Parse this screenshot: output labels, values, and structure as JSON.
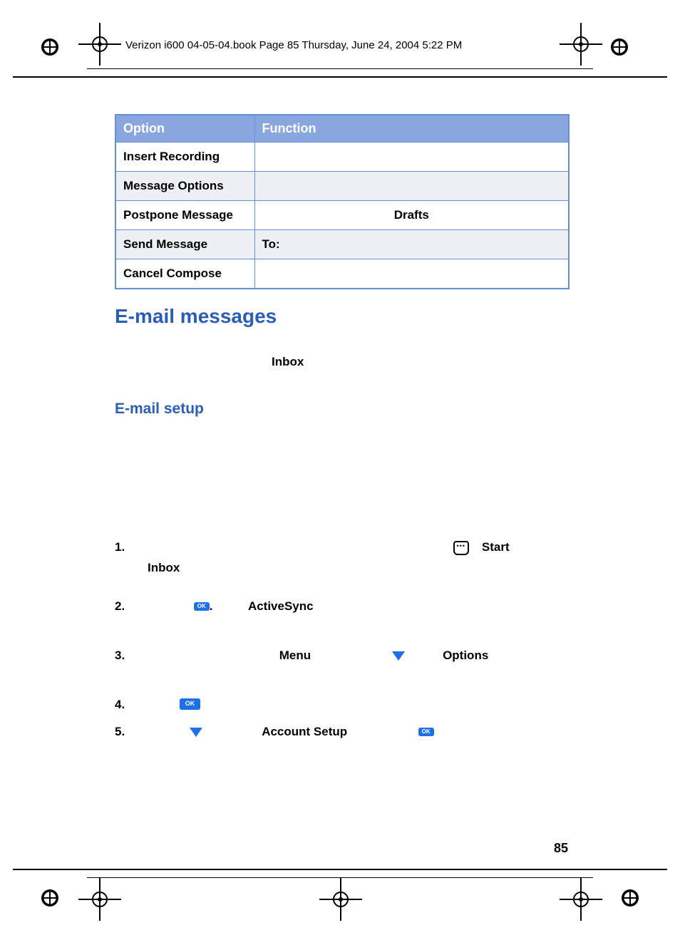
{
  "header": "Verizon i600 04-05-04.book  Page 85  Thursday, June 24, 2004  5:22 PM",
  "table": {
    "head_option": "Option",
    "head_function": "Function",
    "rows": {
      "r0": {
        "opt": "Insert Recording",
        "func": ""
      },
      "r1": {
        "opt": "Message Options",
        "func": ""
      },
      "r2": {
        "opt": "Postpone Message",
        "func": "Drafts"
      },
      "r3": {
        "opt": "Send Message",
        "func": "To:"
      },
      "r4": {
        "opt": "Cancel Compose",
        "func": ""
      }
    }
  },
  "headings": {
    "email_messages": "E-mail messages",
    "inbox": "Inbox",
    "email_setup": "E-mail setup"
  },
  "steps": {
    "s1": {
      "num": "1.",
      "start": "Start",
      "inbox": "Inbox"
    },
    "s2": {
      "num": "2.",
      "dot": ".",
      "activesync": "ActiveSync"
    },
    "s3": {
      "num": "3.",
      "menu": "Menu",
      "options": "Options"
    },
    "s4": {
      "num": "4."
    },
    "s5": {
      "num": "5.",
      "account_setup": "Account Setup"
    }
  },
  "icons": {
    "ok": "OK"
  },
  "page_number": "85"
}
